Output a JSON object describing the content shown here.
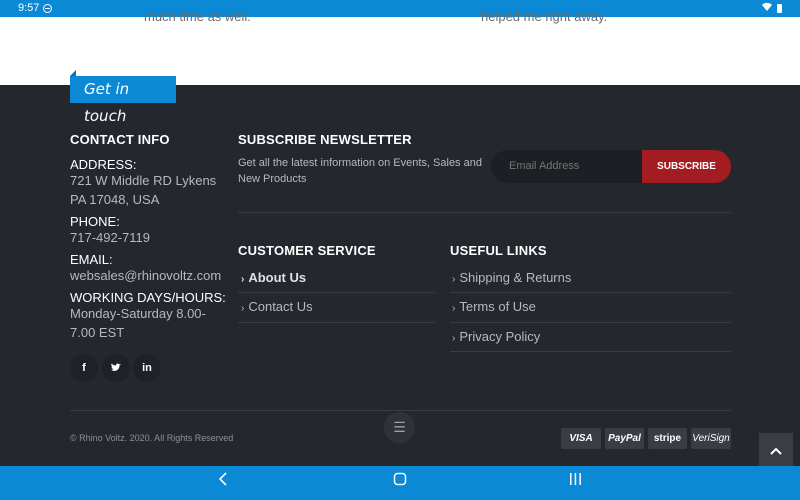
{
  "status_bar": {
    "time": "9:57"
  },
  "testimonials": [
    "much time as well.",
    "helped me right away."
  ],
  "get_in_touch": "Get in touch",
  "contact": {
    "heading": "CONTACT INFO",
    "address_label": "ADDRESS:",
    "address_line1": "721 W Middle RD Lykens",
    "address_line2": "PA 17048, USA",
    "phone_label": "PHONE:",
    "phone": "717-492-7119",
    "email_label": "EMAIL:",
    "email": "websales@rhinovoltz.com",
    "hours_label": "WORKING DAYS/HOURS:",
    "hours_line1": "Monday-Saturday 8.00-",
    "hours_line2": "7.00 EST"
  },
  "social": {
    "facebook": "f",
    "twitter": "ᵛ",
    "linkedin": "in"
  },
  "newsletter": {
    "heading": "SUBSCRIBE NEWSLETTER",
    "description": "Get all the latest information on Events, Sales and New Products",
    "email_placeholder": "Email Address",
    "button": "SUBSCRIBE"
  },
  "customer_service": {
    "heading": "CUSTOMER SERVICE",
    "links": [
      "About Us",
      "Contact Us"
    ]
  },
  "useful_links": {
    "heading": "USEFUL LINKS",
    "links": [
      "Shipping & Returns",
      "Terms of Use",
      "Privacy Policy"
    ]
  },
  "copyright": "© Rhino Voltz. 2020. All Rights Reserved",
  "payments": [
    "VISA",
    "PayPal",
    "stripe",
    "VeriSign"
  ],
  "colors": {
    "accent_blue": "#0b89d4",
    "subscribe_red": "#a31c22",
    "footer_bg": "#24272d"
  }
}
